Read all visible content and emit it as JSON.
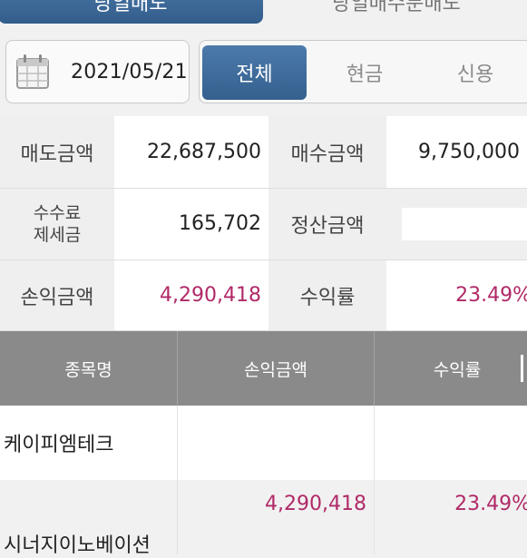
{
  "top_tabs": [
    {
      "label": "당일매도",
      "active": true
    },
    {
      "label": "당일매수분매도",
      "active": false
    }
  ],
  "date_filter": {
    "value": "2021/05/21",
    "icon": "calendar-icon"
  },
  "segments": [
    {
      "label": "전체",
      "active": true
    },
    {
      "label": "현금",
      "active": false
    },
    {
      "label": "신용",
      "active": false
    }
  ],
  "summary": {
    "sell_amount_label": "매도금액",
    "sell_amount": "22,687,500",
    "buy_amount_label": "매수금액",
    "buy_amount": "9,750,000",
    "fee_tax_label_line1": "수수료",
    "fee_tax_label_line2": "제세금",
    "fee_tax": "165,702",
    "settlement_label": "정산금액",
    "settlement": "",
    "profit_label": "손익금액",
    "profit": "4,290,418",
    "return_label": "수익률",
    "return_rate": "23.49%"
  },
  "list": {
    "headers": [
      "종목명",
      "손익금액",
      "수익률"
    ],
    "rows": [
      {
        "name": "케이피엠테크",
        "profit": "",
        "rate": ""
      },
      {
        "name": "시너지이노베이션",
        "profit": "4,290,418",
        "rate": "23.49%"
      }
    ]
  },
  "colors": {
    "accent_blue": "#3d6a9a",
    "loss_profit_red": "#b02a67",
    "header_gray": "#8a8a8a"
  }
}
